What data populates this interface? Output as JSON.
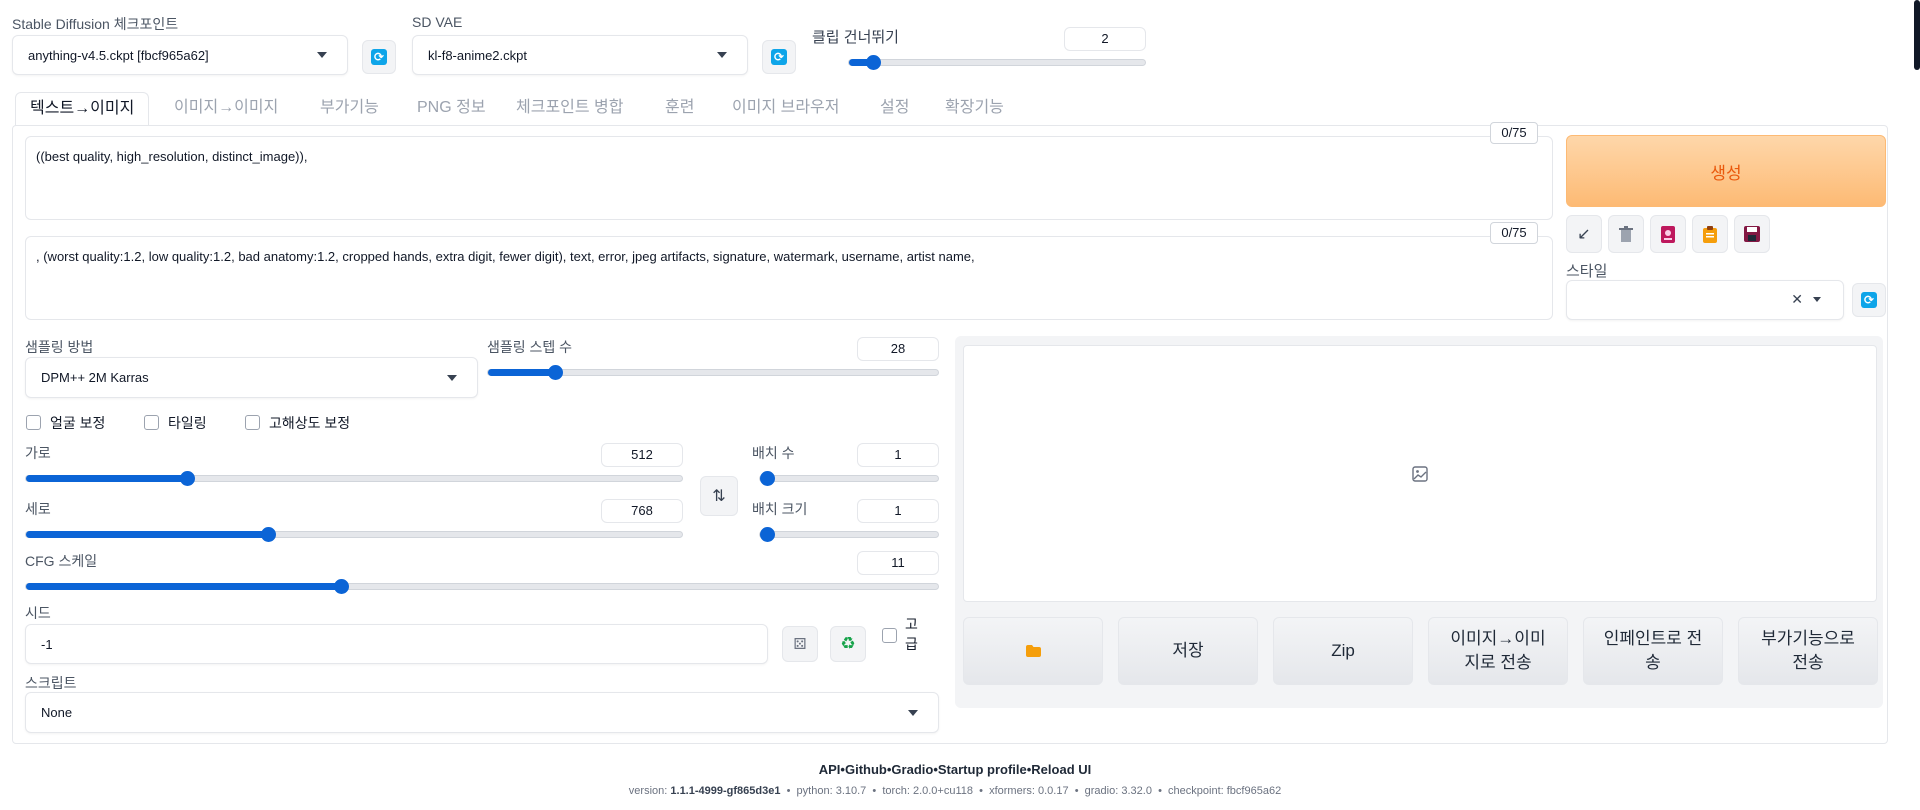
{
  "top": {
    "checkpoint_label": "Stable Diffusion 체크포인트",
    "checkpoint_value": "anything-v4.5.ckpt [fbcf965a62]",
    "vae_label": "SD VAE",
    "vae_value": "kl-f8-anime2.ckpt",
    "clip_skip_label": "클립 건너뛰기",
    "clip_skip_value": "2",
    "clip_skip_fraction": 0.08
  },
  "tabs": [
    {
      "label": "텍스트→이미지",
      "active": true
    },
    {
      "label": "이미지→이미지"
    },
    {
      "label": "부가기능"
    },
    {
      "label": "PNG 정보"
    },
    {
      "label": "체크포인트 병합"
    },
    {
      "label": "훈련"
    },
    {
      "label": "이미지 브라우저"
    },
    {
      "label": "설정"
    },
    {
      "label": "확장기능"
    }
  ],
  "prompt": {
    "positive": "((best quality, high_resolution, distinct_image)),",
    "positive_counter": "0/75",
    "negative": ", (worst quality:1.2, low quality:1.2, bad anatomy:1.2, cropped hands, extra digit, fewer digit), text, error, jpeg artifacts, signature, watermark, username, artist name,",
    "negative_counter": "0/75"
  },
  "generate_label": "생성",
  "style_label": "스타일",
  "sampling": {
    "method_label": "샘플링 방법",
    "method_value": "DPM++ 2M Karras",
    "steps_label": "샘플링 스텝 수",
    "steps_value": "28",
    "steps_fraction": 0.148
  },
  "checks": {
    "face": "얼굴 보정",
    "tiling": "타일링",
    "hires": "고해상도 보정"
  },
  "size": {
    "width_label": "가로",
    "width_value": "512",
    "width_fraction": 0.245,
    "height_label": "세로",
    "height_value": "768",
    "height_fraction": 0.369,
    "batch_count_label": "배치 수",
    "batch_count_value": "1",
    "batch_size_label": "배치 크기",
    "batch_size_value": "1"
  },
  "cfg": {
    "label": "CFG 스케일",
    "value": "11",
    "fraction": 0.345
  },
  "seed": {
    "label": "시드",
    "value": "-1",
    "advanced_label": "고급"
  },
  "script": {
    "label": "스크립트",
    "value": "None"
  },
  "output_buttons": {
    "save": "저장",
    "zip": "Zip",
    "to_img2img": "이미지→이미지로 전송",
    "to_inpaint": "인페인트로 전송",
    "to_extras": "부가기능으로 전송"
  },
  "footer": {
    "links": [
      "API",
      "Github",
      "Gradio",
      "Startup profile",
      "Reload UI"
    ],
    "version_label": "version:",
    "version": "1.1.1-4999-gf865d3e1",
    "python_label": "python:",
    "python": "3.10.7",
    "torch_label": "torch:",
    "torch": "2.0.0+cu118",
    "xformers_label": "xformers:",
    "xformers": "0.0.17",
    "gradio_label": "gradio:",
    "gradio": "3.32.0",
    "checkpoint_label": "checkpoint:",
    "checkpoint": "fbcf965a62"
  },
  "colors": {
    "accent": "#0b64d6",
    "generate_text": "#ea580c",
    "refresh": "#0ea5e9"
  }
}
